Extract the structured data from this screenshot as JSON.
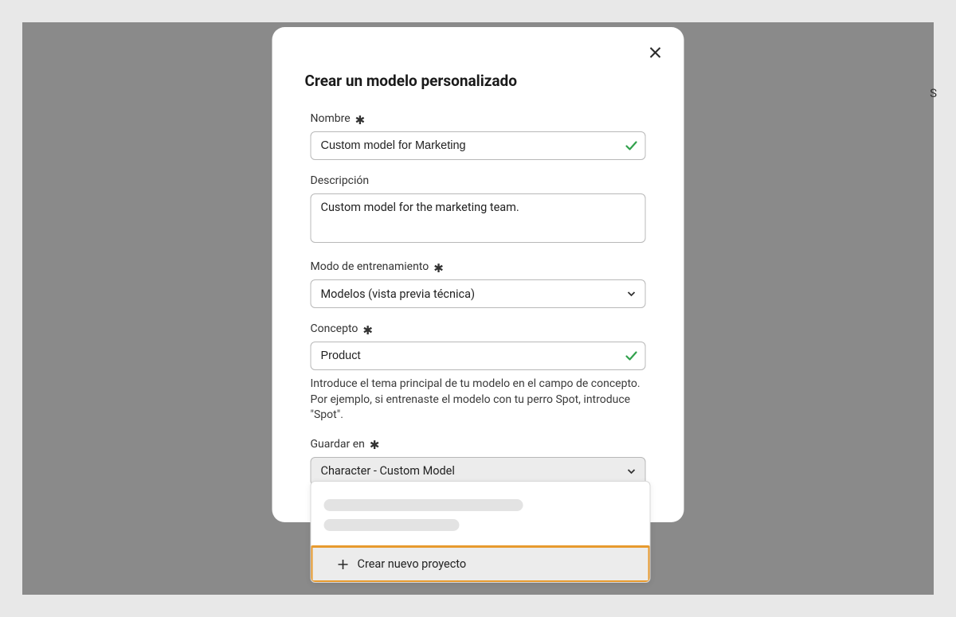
{
  "edge_char": "S",
  "modal": {
    "title": "Crear un modelo personalizado",
    "close_aria": "Cerrar",
    "fields": {
      "name": {
        "label": "Nombre",
        "required": true,
        "value": "Custom model for Marketing",
        "validated": true
      },
      "description": {
        "label": "Descripción",
        "value": "Custom model for the marketing team."
      },
      "training_mode": {
        "label": "Modo de entrenamiento",
        "required": true,
        "selected": "Modelos (vista previa técnica)"
      },
      "concept": {
        "label": "Concepto",
        "required": true,
        "value": "Product",
        "validated": true,
        "help": "Introduce el tema principal de tu modelo en el campo de concepto. Por ejemplo, si entrenaste el modelo con tu perro Spot, introduce \"Spot\"."
      },
      "save_in": {
        "label": "Guardar en",
        "required": true,
        "selected": "Character - Custom Model"
      }
    },
    "dropdown": {
      "create_new_label": "Crear nuevo proyecto"
    }
  }
}
